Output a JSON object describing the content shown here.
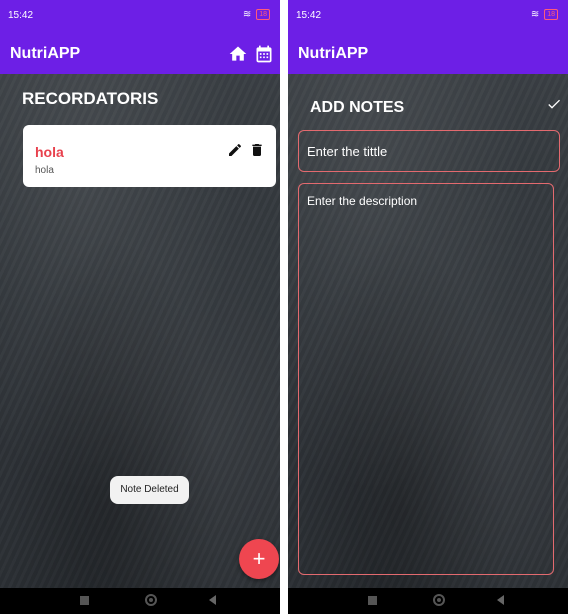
{
  "status_bar": {
    "time": "15:42",
    "battery": "18"
  },
  "app": {
    "title": "NutriAPP"
  },
  "reminders_screen": {
    "heading": "RECORDATORIS",
    "notes": [
      {
        "title": "hola",
        "description": "hola"
      }
    ],
    "toast": "Note Deleted",
    "fab_label": "+"
  },
  "add_note_screen": {
    "heading": "ADD NOTES",
    "title_placeholder": "Enter the tittle",
    "description_placeholder": "Enter the description"
  },
  "colors": {
    "app_bar": "#6d1fe6",
    "note_title": "#e8414d",
    "fab": "#ef4650",
    "input_border": "#e36a6f"
  },
  "icons": [
    "home-icon",
    "calendar-icon",
    "edit-icon",
    "delete-icon",
    "check-icon",
    "plus-icon"
  ]
}
